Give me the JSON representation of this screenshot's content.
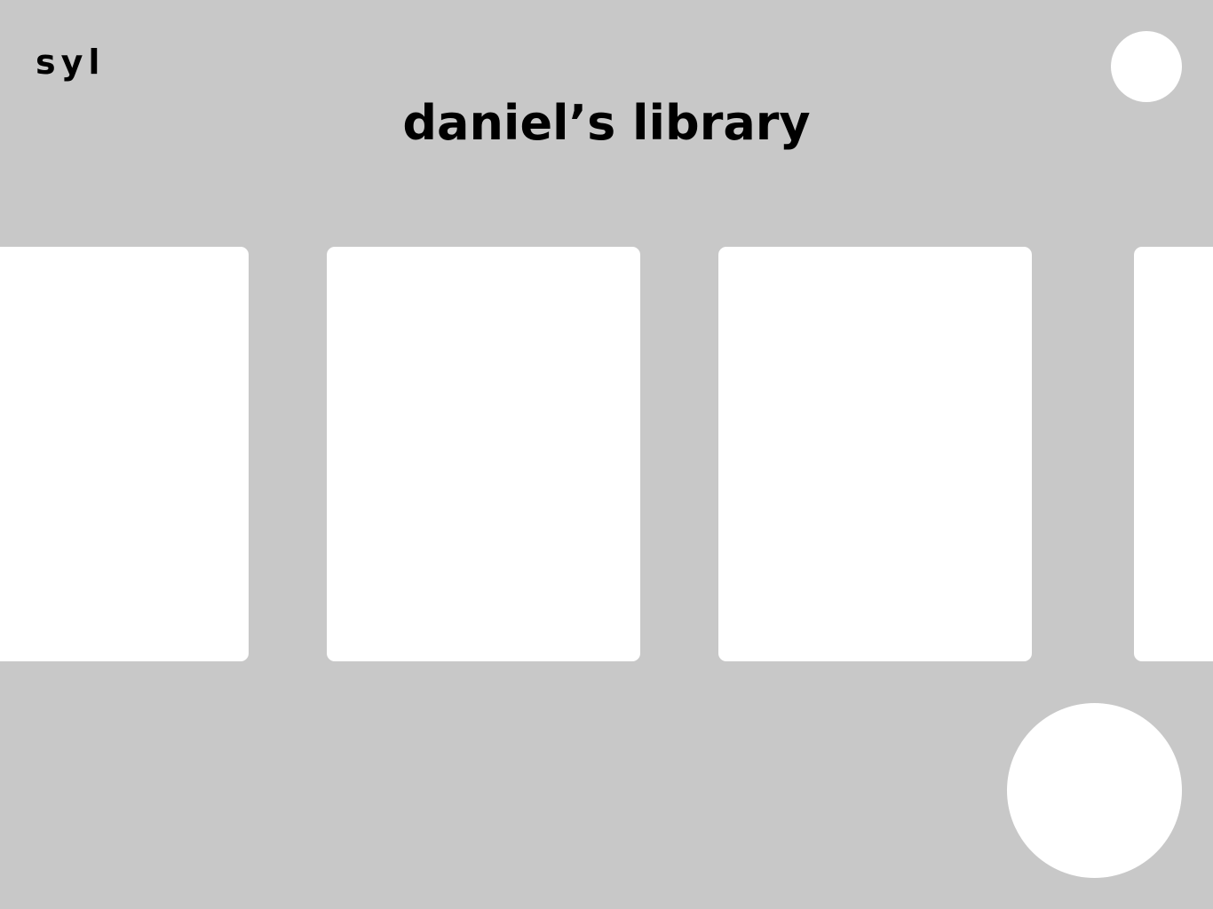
{
  "theme": {
    "background": "#c8c8c8",
    "card": "#ffffff",
    "text": "#000000"
  },
  "header": {
    "logo": "syl",
    "title": "daniel’s library"
  },
  "library": {
    "books": [
      {
        "id": "book-1"
      },
      {
        "id": "book-2"
      },
      {
        "id": "book-3"
      },
      {
        "id": "book-4"
      }
    ]
  }
}
